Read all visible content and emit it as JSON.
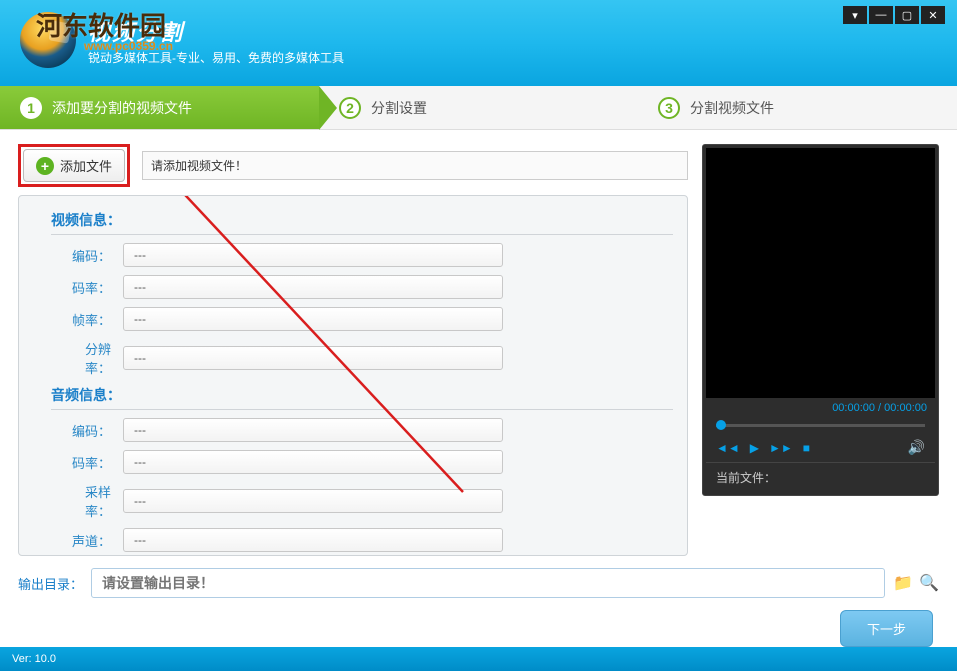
{
  "watermark": {
    "main": "河东软件园",
    "sub": "www.pc0359.cn"
  },
  "header": {
    "title": "视频分割",
    "subtitle": "锐动多媒体工具-专业、易用、免费的多媒体工具"
  },
  "steps": {
    "s1": {
      "num": "1",
      "label": "添加要分割的视频文件"
    },
    "s2": {
      "num": "2",
      "label": "分割设置"
    },
    "s3": {
      "num": "3",
      "label": "分割视频文件"
    }
  },
  "add": {
    "button": "添加文件",
    "prompt": "请添加视频文件！"
  },
  "video_info": {
    "title": "视频信息：",
    "rows": [
      {
        "label": "编码：",
        "value": "---"
      },
      {
        "label": "码率：",
        "value": "---"
      },
      {
        "label": "帧率：",
        "value": "---"
      },
      {
        "label": "分辨率：",
        "value": "---"
      }
    ]
  },
  "audio_info": {
    "title": "音频信息：",
    "rows": [
      {
        "label": "编码：",
        "value": "---"
      },
      {
        "label": "码率：",
        "value": "---"
      },
      {
        "label": "采样率：",
        "value": "---"
      },
      {
        "label": "声道：",
        "value": "---"
      }
    ]
  },
  "player": {
    "time": "00:00:00 / 00:00:00",
    "current_label": "当前文件：",
    "current_file": ""
  },
  "output": {
    "label": "输出目录：",
    "placeholder": "请设置输出目录！"
  },
  "next": "下一步",
  "footer": {
    "version": "Ver: 10.0"
  }
}
